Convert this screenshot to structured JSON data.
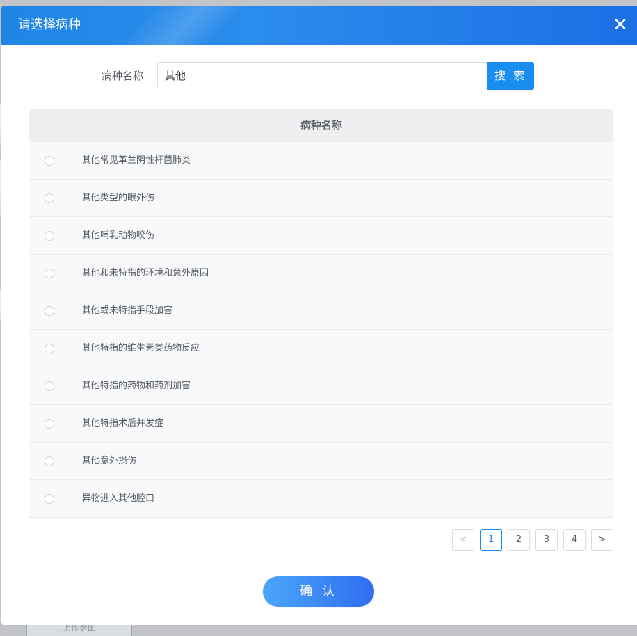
{
  "dialog": {
    "title": "请选择病种",
    "close_icon": "close-icon"
  },
  "search": {
    "label": "病种名称",
    "value": "其他",
    "button_label": "搜 索"
  },
  "table": {
    "column_header": "病种名称",
    "rows": [
      {
        "name": "其他常见革兰阴性杆菌肺炎",
        "selected": false
      },
      {
        "name": "其他类型的眼外伤",
        "selected": false
      },
      {
        "name": "其他哺乳动物咬伤",
        "selected": false
      },
      {
        "name": "其他和未特指的环境和意外原因",
        "selected": false
      },
      {
        "name": "其他或未特指手段加害",
        "selected": false
      },
      {
        "name": "其他特指的维生素类药物反应",
        "selected": false
      },
      {
        "name": "其他特指的药物和药剂加害",
        "selected": false
      },
      {
        "name": "其他特指术后并发症",
        "selected": false
      },
      {
        "name": "其他意外损伤",
        "selected": false
      },
      {
        "name": "异物进入其他腔口",
        "selected": false
      }
    ]
  },
  "pagination": {
    "prev": "<",
    "pages": [
      "1",
      "2",
      "3",
      "4"
    ],
    "current": "1",
    "next": ">"
  },
  "footer": {
    "confirm_label": "确 认"
  },
  "background": {
    "upload_label": "上传参图"
  },
  "colors": {
    "primary": "#1a8df0",
    "header_gradient_start": "#1f86e6",
    "header_gradient_end": "#1c6fe6",
    "confirm_gradient_start": "#4aa6f7",
    "confirm_gradient_end": "#2f6df2"
  }
}
